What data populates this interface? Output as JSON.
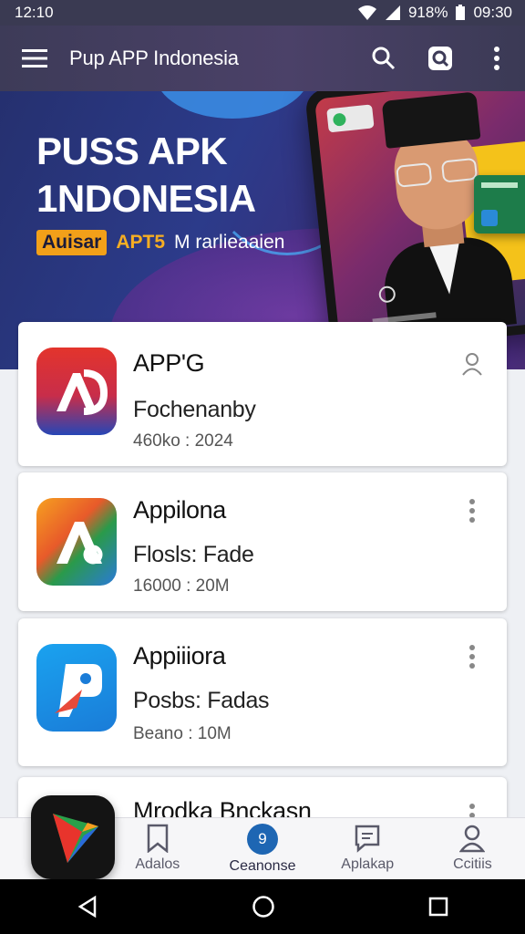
{
  "status_bar": {
    "time": "12:10",
    "battery": "918%",
    "clock": "09:30"
  },
  "app_bar": {
    "title": "Pup APP Indonesia"
  },
  "banner": {
    "headline_line1": "PUSS APK",
    "headline_line2": "1NDONESIA",
    "pill": "Auisar",
    "apt": "APT5",
    "tagline_rest": "M rarlieaaien"
  },
  "apps": [
    {
      "name": "APP'G",
      "subtitle": "Fochenanby",
      "meta": "460ko : 2024",
      "action_icon": "person-icon",
      "colors": [
        "#e0302a",
        "#2948b8"
      ]
    },
    {
      "name": "Appilona",
      "subtitle": "Flosls: Fade",
      "meta": "16000 : 20M",
      "action_icon": "more-vert-icon",
      "colors": [
        "#f6a020",
        "#2a9a4a",
        "#2a7ad8"
      ]
    },
    {
      "name": "Appiiiora",
      "subtitle": "Posbs: Fadas",
      "meta": "Beano : 10M",
      "action_icon": "more-vert-icon",
      "colors": [
        "#1a8fe0",
        "#e84a3a"
      ]
    },
    {
      "name": "Mrodka Bnckasn",
      "action_icon": "more-vert-icon"
    }
  ],
  "bottom_nav": [
    {
      "label": "Adalos",
      "icon": "bookmark-icon"
    },
    {
      "label": "Ceanonse",
      "icon": "badge-icon",
      "badge": "9"
    },
    {
      "label": "Aplakap",
      "icon": "message-icon"
    },
    {
      "label": "Ccitiis",
      "icon": "profile-icon"
    }
  ]
}
